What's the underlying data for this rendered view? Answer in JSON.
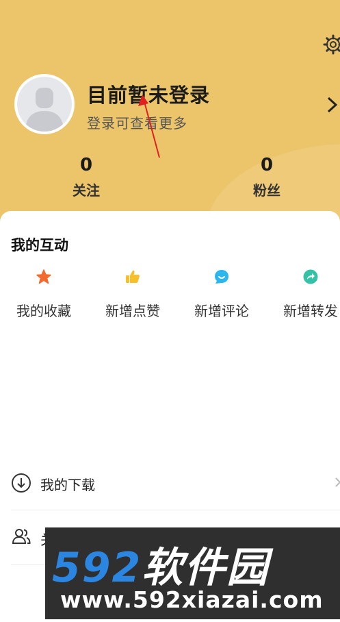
{
  "profile": {
    "title": "目前暂未登录",
    "subtitle": "登录可查看更多",
    "stats": [
      {
        "value": "0",
        "label": "关注"
      },
      {
        "value": "0",
        "label": "粉丝"
      }
    ]
  },
  "interactions": {
    "title": "我的互动",
    "items": [
      {
        "label": "我的收藏",
        "icon": "star-icon",
        "color": "#f26a2e"
      },
      {
        "label": "新增点赞",
        "icon": "thumbs-up-icon",
        "color": "#f6c02a"
      },
      {
        "label": "新增评论",
        "icon": "comment-icon",
        "color": "#2bb6f0"
      },
      {
        "label": "新增转发",
        "icon": "share-icon",
        "color": "#33c2a6"
      }
    ]
  },
  "menu": [
    {
      "label": "我的下载",
      "icon": "download-icon"
    },
    {
      "label": "关",
      "icon": "people-icon"
    }
  ],
  "watermark": {
    "brand_digits": "592",
    "brand_text": "软件园",
    "url": "www.592xiazai.com"
  },
  "colors": {
    "header_bg": "#ecc56a",
    "annotation_arrow": "#e02020"
  }
}
